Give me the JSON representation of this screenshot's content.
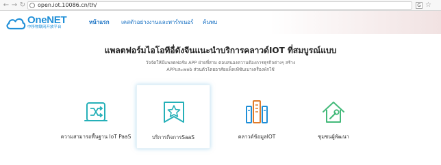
{
  "browser": {
    "url": "open.iot.10086.cn/th/",
    "translate_label": "G"
  },
  "header": {
    "logo_text": "OneNET",
    "logo_subtitle": "中移物联网开放平台",
    "nav": [
      {
        "label": "หน้าแรก",
        "active": true
      },
      {
        "label": "เคสตัวอย่างงานและพาร์ทเนอร์",
        "active": false
      },
      {
        "label": "ค้นพบ",
        "active": false
      }
    ]
  },
  "hero": {
    "title": "แพลตฟอร์มไอโอทีอื่ดังจีนแนะนำบริการคลาวด์IOT ที่สมบูรณ์แบบ",
    "description": "วัจจัดให้มีแพลตฟอร์ม APP ฝ่ายที่สาม ตอบสนองความต้องการธุรกิจต่างๆ สร้าง APPและweb ส่วนตัวโดยอาศัยแพ็ลเฟ้ชันเบาเครื่องพักใช้"
  },
  "cards": [
    {
      "label": "ความสามารถพื้นฐาน IoT PaaS",
      "icon": "shuffle-icon",
      "selected": false
    },
    {
      "label": "บริการกิจการSaaS",
      "icon": "star-bookmark-icon",
      "selected": true
    },
    {
      "label": "คลาวด์ข้อมูลIOT",
      "icon": "server-cloud-icon",
      "selected": false
    },
    {
      "label": "ชุมชนผู้พัฒนา",
      "icon": "house-tool-icon",
      "selected": false
    }
  ],
  "colors": {
    "accent": "#1f8fd8",
    "icon_teal": "#25b0b8",
    "icon_blue": "#1f8fd8",
    "icon_green": "#42b979"
  }
}
